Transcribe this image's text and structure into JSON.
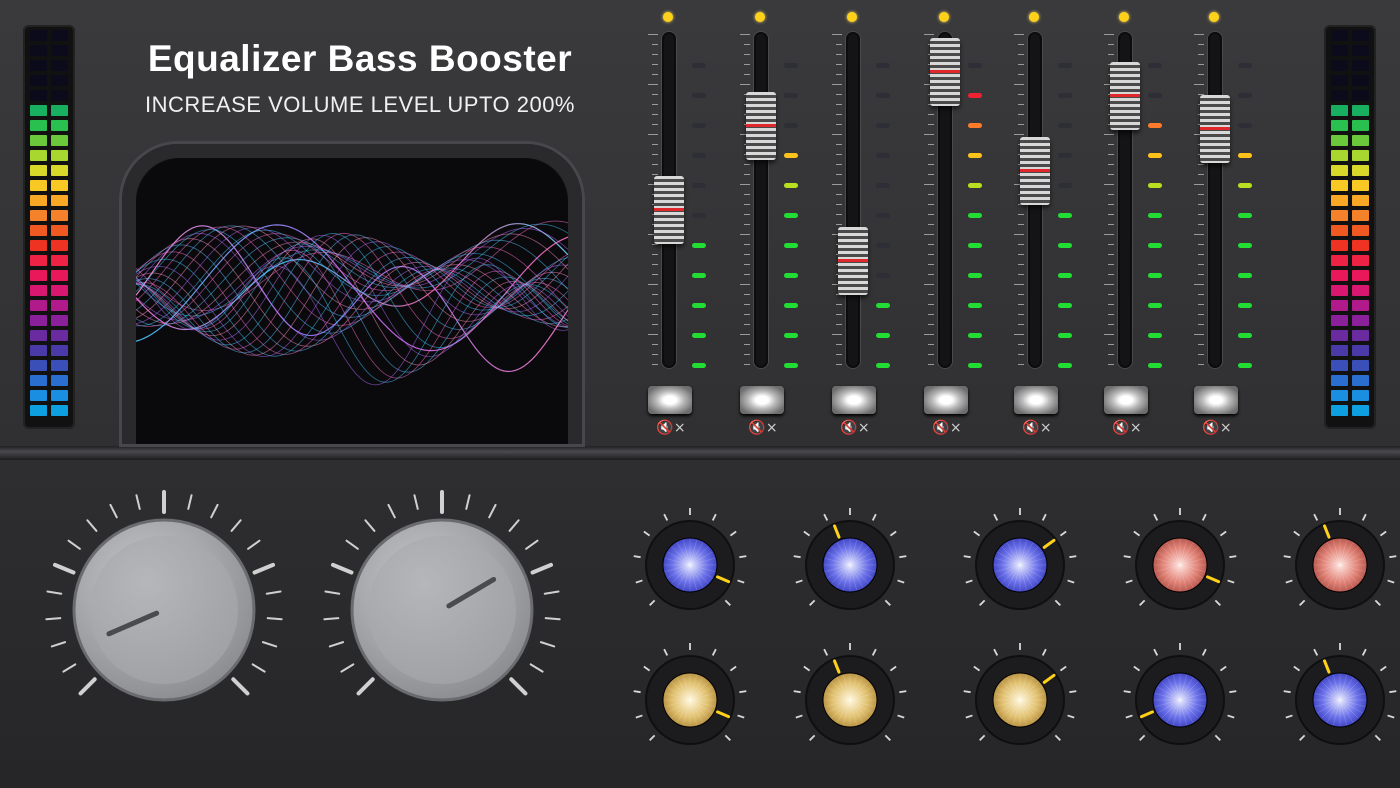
{
  "header": {
    "title": "Equalizer Bass Booster",
    "subtitle": "INCREASE VOLUME LEVEL UPTO 200%"
  },
  "mute_icon": "mute-speaker-icon",
  "mute_glyph": "🔇×",
  "colors": {
    "accent_yellow": "#ffd11a",
    "led_green": "#22dd33",
    "led_lime": "#b8e020",
    "led_yellow": "#ffc21a",
    "led_orange": "#ff7a2a",
    "led_red": "#ee2233"
  },
  "faders": [
    {
      "level": 0.42
    },
    {
      "level": 0.7
    },
    {
      "level": 0.25
    },
    {
      "level": 0.88
    },
    {
      "level": 0.55
    },
    {
      "level": 0.8
    },
    {
      "level": 0.69
    }
  ],
  "vu_meters": {
    "left_columns": [
      [
        1,
        0.91
      ],
      [
        1,
        0.82
      ]
    ],
    "right_columns": [
      [
        1,
        0.82
      ],
      [
        1,
        0.87
      ]
    ]
  },
  "big_knobs": [
    {
      "name": "bass",
      "level": 0.08
    },
    {
      "name": "volume",
      "level": 0.72
    }
  ],
  "small_knobs": [
    {
      "color": "blue",
      "level": 0.92
    },
    {
      "color": "blue",
      "level": 0.42
    },
    {
      "color": "blue",
      "level": 0.7
    },
    {
      "color": "red",
      "level": 0.92
    },
    {
      "color": "red",
      "level": 0.42
    },
    {
      "color": "gold",
      "level": 0.92
    },
    {
      "color": "gold",
      "level": 0.42
    },
    {
      "color": "gold",
      "level": 0.7
    },
    {
      "color": "blue",
      "level": 0.08
    },
    {
      "color": "blue",
      "level": 0.42
    }
  ]
}
